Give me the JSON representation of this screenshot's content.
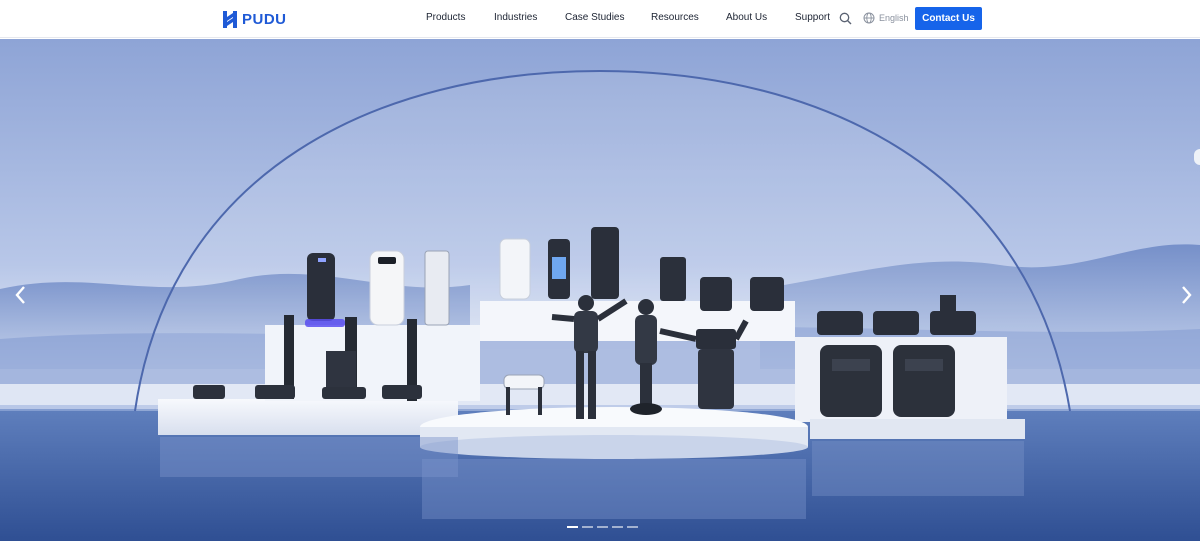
{
  "brand": {
    "name": "PUDU",
    "color": "#1f5ad6",
    "logo_icon": "pudu-logo-mark"
  },
  "nav": {
    "items": [
      {
        "label": "Products"
      },
      {
        "label": "Industries"
      },
      {
        "label": "Case Studies"
      },
      {
        "label": "Resources"
      },
      {
        "label": "About Us"
      },
      {
        "label": "Support"
      }
    ],
    "search_icon": "search-icon",
    "language_icon": "globe-icon",
    "language": "English",
    "cta_label": "Contact Us",
    "cta_color": "#1664ea"
  },
  "hero": {
    "description_icon": "product-lineup-image",
    "carousel": {
      "slides": 5,
      "active_slide": 1,
      "prev_icon": "chevron-left-icon",
      "next_icon": "chevron-right-icon"
    },
    "colors": {
      "sky_top": "#97acd9",
      "sky_bottom": "#d9e2f3",
      "water": "#3d5fa6",
      "platform": "#eef1f8",
      "robot_dark": "#23272f"
    }
  }
}
